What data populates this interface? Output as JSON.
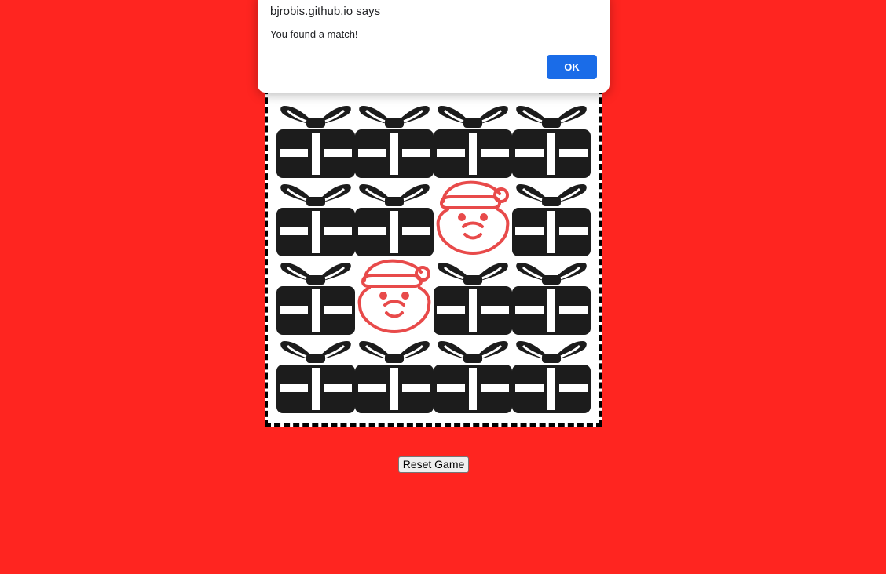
{
  "dialog": {
    "origin": "bjrobis.github.io says",
    "message": "You found a match!",
    "ok_label": "OK"
  },
  "game": {
    "reset_label": "Reset Game",
    "grid": [
      [
        "gift-icon",
        "gift-icon",
        "gift-icon",
        "gift-icon"
      ],
      [
        "gift-icon",
        "gift-icon",
        "santa-icon",
        "gift-icon"
      ],
      [
        "gift-icon",
        "santa-icon",
        "gift-icon",
        "gift-icon"
      ],
      [
        "gift-icon",
        "gift-icon",
        "gift-icon",
        "gift-icon"
      ]
    ]
  },
  "colors": {
    "background": "#ff2520",
    "board": "#ffffff",
    "gift": "#1c1c1c",
    "santa": "#e84a4a",
    "ok_button": "#1a6ce8"
  }
}
